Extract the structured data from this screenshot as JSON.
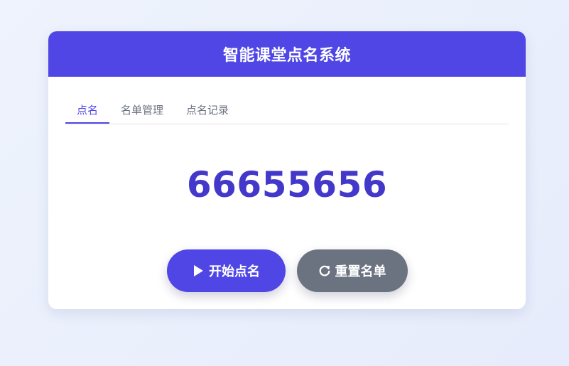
{
  "header": {
    "title": "智能课堂点名系统"
  },
  "tabs": [
    {
      "label": "点名",
      "active": true
    },
    {
      "label": "名单管理",
      "active": false
    },
    {
      "label": "点名记录",
      "active": false
    }
  ],
  "display": {
    "current_name": "66655656"
  },
  "actions": {
    "start_label": "开始点名",
    "start_icon": "play-icon",
    "reset_label": "重置名单",
    "reset_icon": "refresh-icon"
  },
  "colors": {
    "primary": "#4f46e5",
    "name_text": "#4338ca",
    "secondary_button": "#6b7280"
  }
}
